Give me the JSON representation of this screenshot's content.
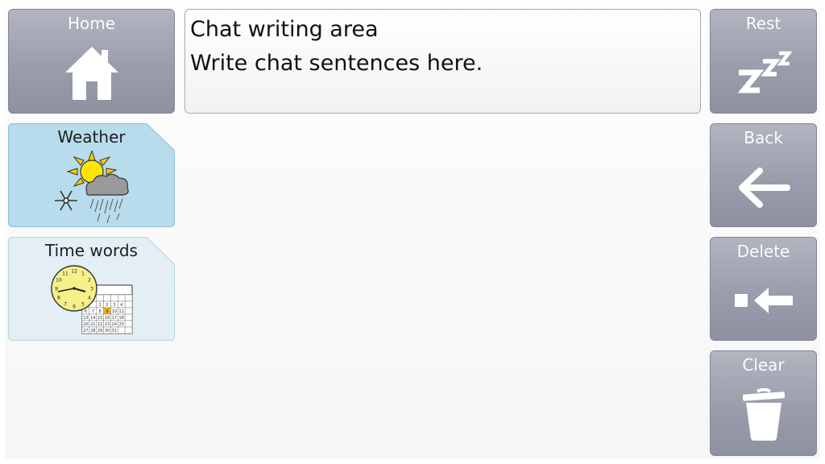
{
  "left_nav": {
    "home": {
      "label": "Home",
      "icon": "house-icon"
    }
  },
  "folders": [
    {
      "label": "Weather",
      "icon": "weather-sun-cloud-snow-icon",
      "color": "#b8dceb"
    },
    {
      "label": "Time words",
      "icon": "clock-calendar-icon",
      "color": "#e3eef5"
    }
  ],
  "chat_area": {
    "title": "Chat writing area",
    "placeholder": "Write chat sentences here."
  },
  "right_nav": {
    "rest": {
      "label": "Rest",
      "icon": "zzz-sleep-icon"
    },
    "back": {
      "label": "Back",
      "icon": "arrow-left-icon"
    },
    "delete": {
      "label": "Delete",
      "icon": "backspace-icon"
    },
    "clear": {
      "label": "Clear",
      "icon": "trash-icon"
    }
  },
  "calendar_numbers": [
    "",
    "",
    "",
    "",
    "",
    "",
    "",
    "",
    "",
    "1",
    "2",
    "3",
    "4",
    "",
    "6",
    "7",
    "8",
    "9",
    "10",
    "11",
    "",
    "13",
    "14",
    "15",
    "16",
    "17",
    "18",
    "",
    "20",
    "21",
    "22",
    "23",
    "24",
    "25",
    "",
    "27",
    "28",
    "29",
    "30",
    "31",
    "",
    ""
  ],
  "clock_numbers": [
    "12",
    "1",
    "2",
    "3",
    "4",
    "5",
    "6",
    "7",
    "8",
    "9",
    "10",
    "11"
  ]
}
